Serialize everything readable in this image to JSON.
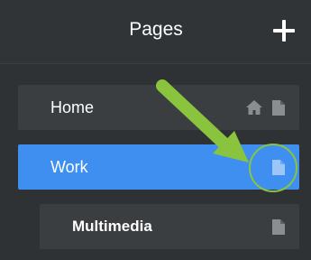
{
  "header": {
    "title": "Pages",
    "add_icon": "plus-icon"
  },
  "pages": [
    {
      "label": "Home",
      "icons": [
        "home-icon",
        "page-icon"
      ],
      "selected": false,
      "level": 0
    },
    {
      "label": "Work",
      "icons": [
        "page-icon"
      ],
      "selected": true,
      "level": 0
    },
    {
      "label": "Multimedia",
      "icons": [
        "page-icon"
      ],
      "selected": false,
      "level": 1
    }
  ],
  "colors": {
    "background": "#2e3234",
    "row": "#3a3e41",
    "selected_row": "#3e8ff0",
    "icon_muted": "#8a8e90",
    "annotation": "#8ac43f"
  }
}
